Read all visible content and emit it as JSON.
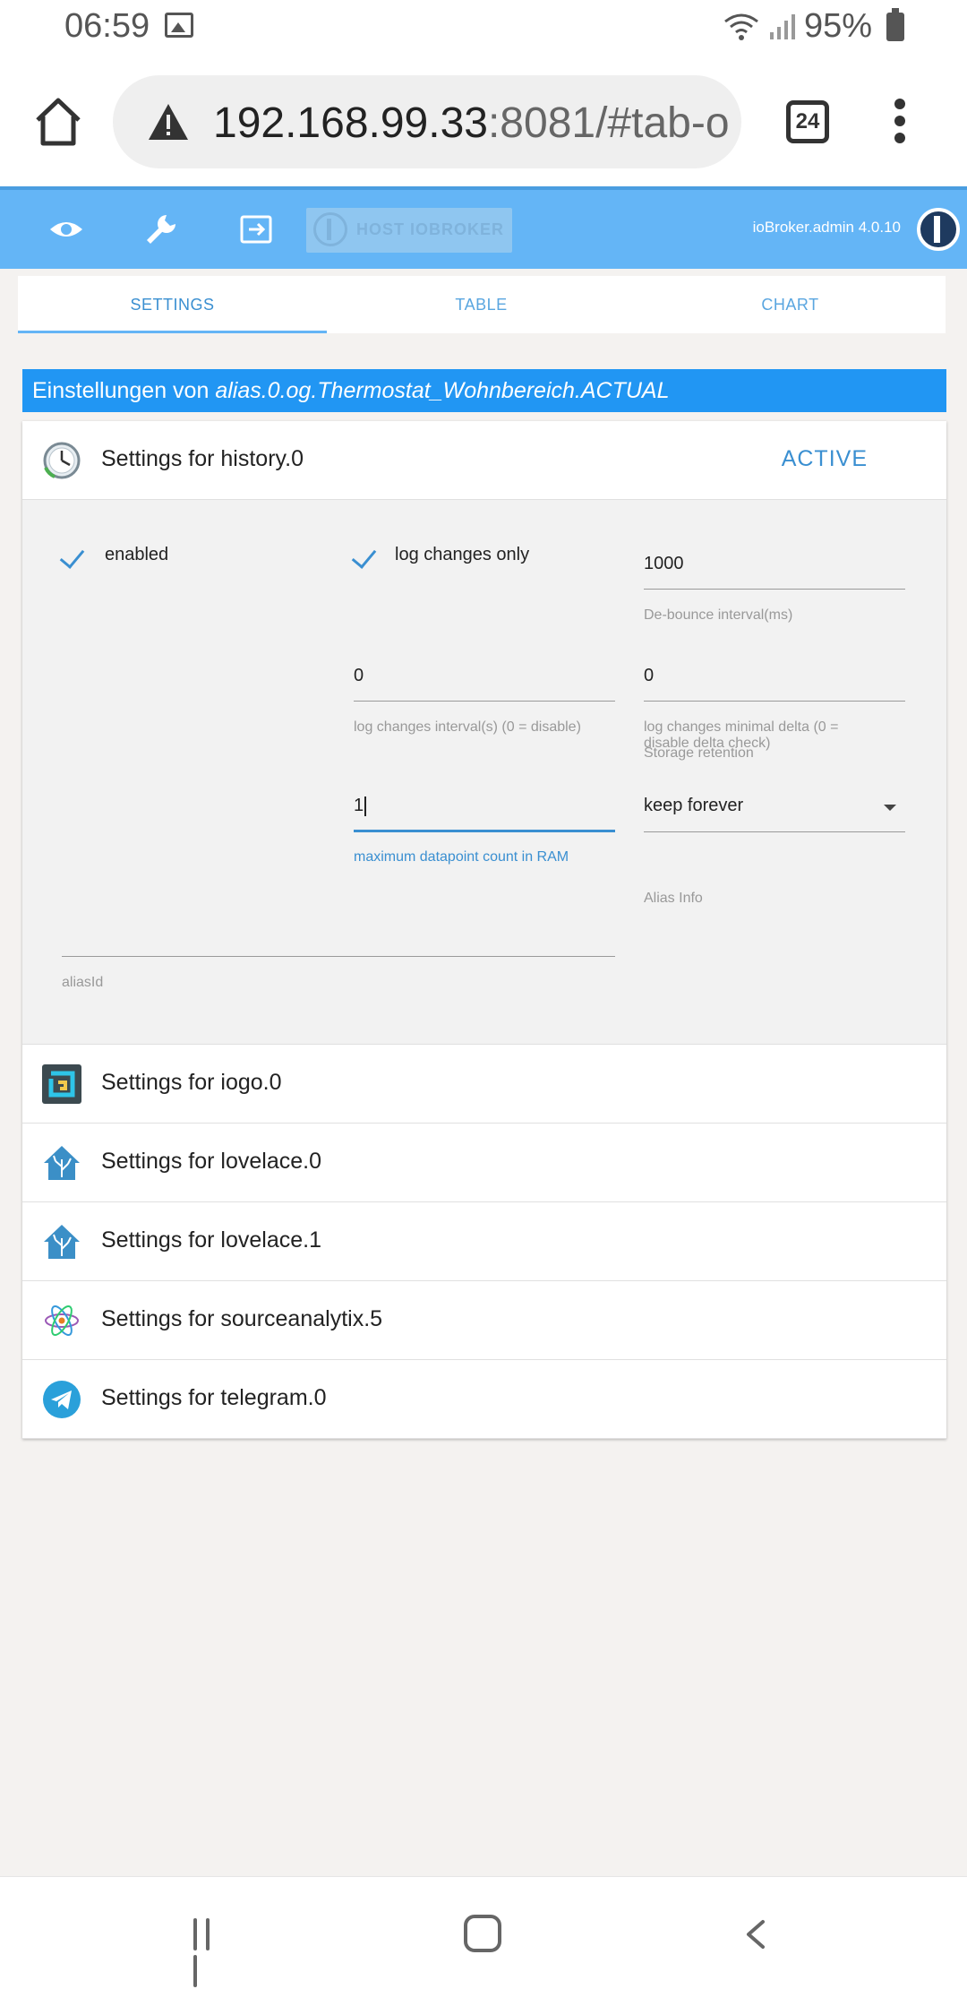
{
  "status_bar": {
    "time": "06:59",
    "battery": "95%"
  },
  "browser": {
    "url_host": "192.168.99.33",
    "url_rest": ":8081/#tab-o",
    "tab_count": "24"
  },
  "toolbar": {
    "host_label": "HOST IOBROKER",
    "version": "ioBroker.admin 4.0.10",
    "accent": "#64b5f6"
  },
  "tabs": [
    {
      "label": "SETTINGS",
      "active": true
    },
    {
      "label": "TABLE",
      "active": false
    },
    {
      "label": "CHART",
      "active": false
    }
  ],
  "heading": {
    "prefix": "Einstellungen von ",
    "object_id": "alias.0.og.Thermostat_Wohnbereich.ACTUAL"
  },
  "history_panel": {
    "title": "Settings for history.0",
    "status": "ACTIVE",
    "enabled_label": "enabled",
    "log_changes_only_label": "log changes only",
    "debounce": {
      "value": "1000",
      "help": "De-bounce interval(ms)"
    },
    "log_changes_interval": {
      "value": "0",
      "help": "log changes interval(s) (0 = disable)"
    },
    "log_changes_delta": {
      "value": "0",
      "help": "log changes minimal delta (0 = disable delta check)"
    },
    "storage_retention": {
      "label": "Storage retention",
      "value": "keep forever"
    },
    "max_datapoints": {
      "value": "1",
      "help": "maximum datapoint count in RAM"
    },
    "alias_info_label": "Alias Info",
    "alias_id": {
      "value": "",
      "help": "aliasId"
    }
  },
  "other_adapters": [
    {
      "title": "Settings for iogo.0",
      "icon": "iogo-icon"
    },
    {
      "title": "Settings for lovelace.0",
      "icon": "lovelace-icon"
    },
    {
      "title": "Settings for lovelace.1",
      "icon": "lovelace-icon"
    },
    {
      "title": "Settings for sourceanalytix.5",
      "icon": "sourceanalytix-icon"
    },
    {
      "title": "Settings for telegram.0",
      "icon": "telegram-icon"
    }
  ]
}
